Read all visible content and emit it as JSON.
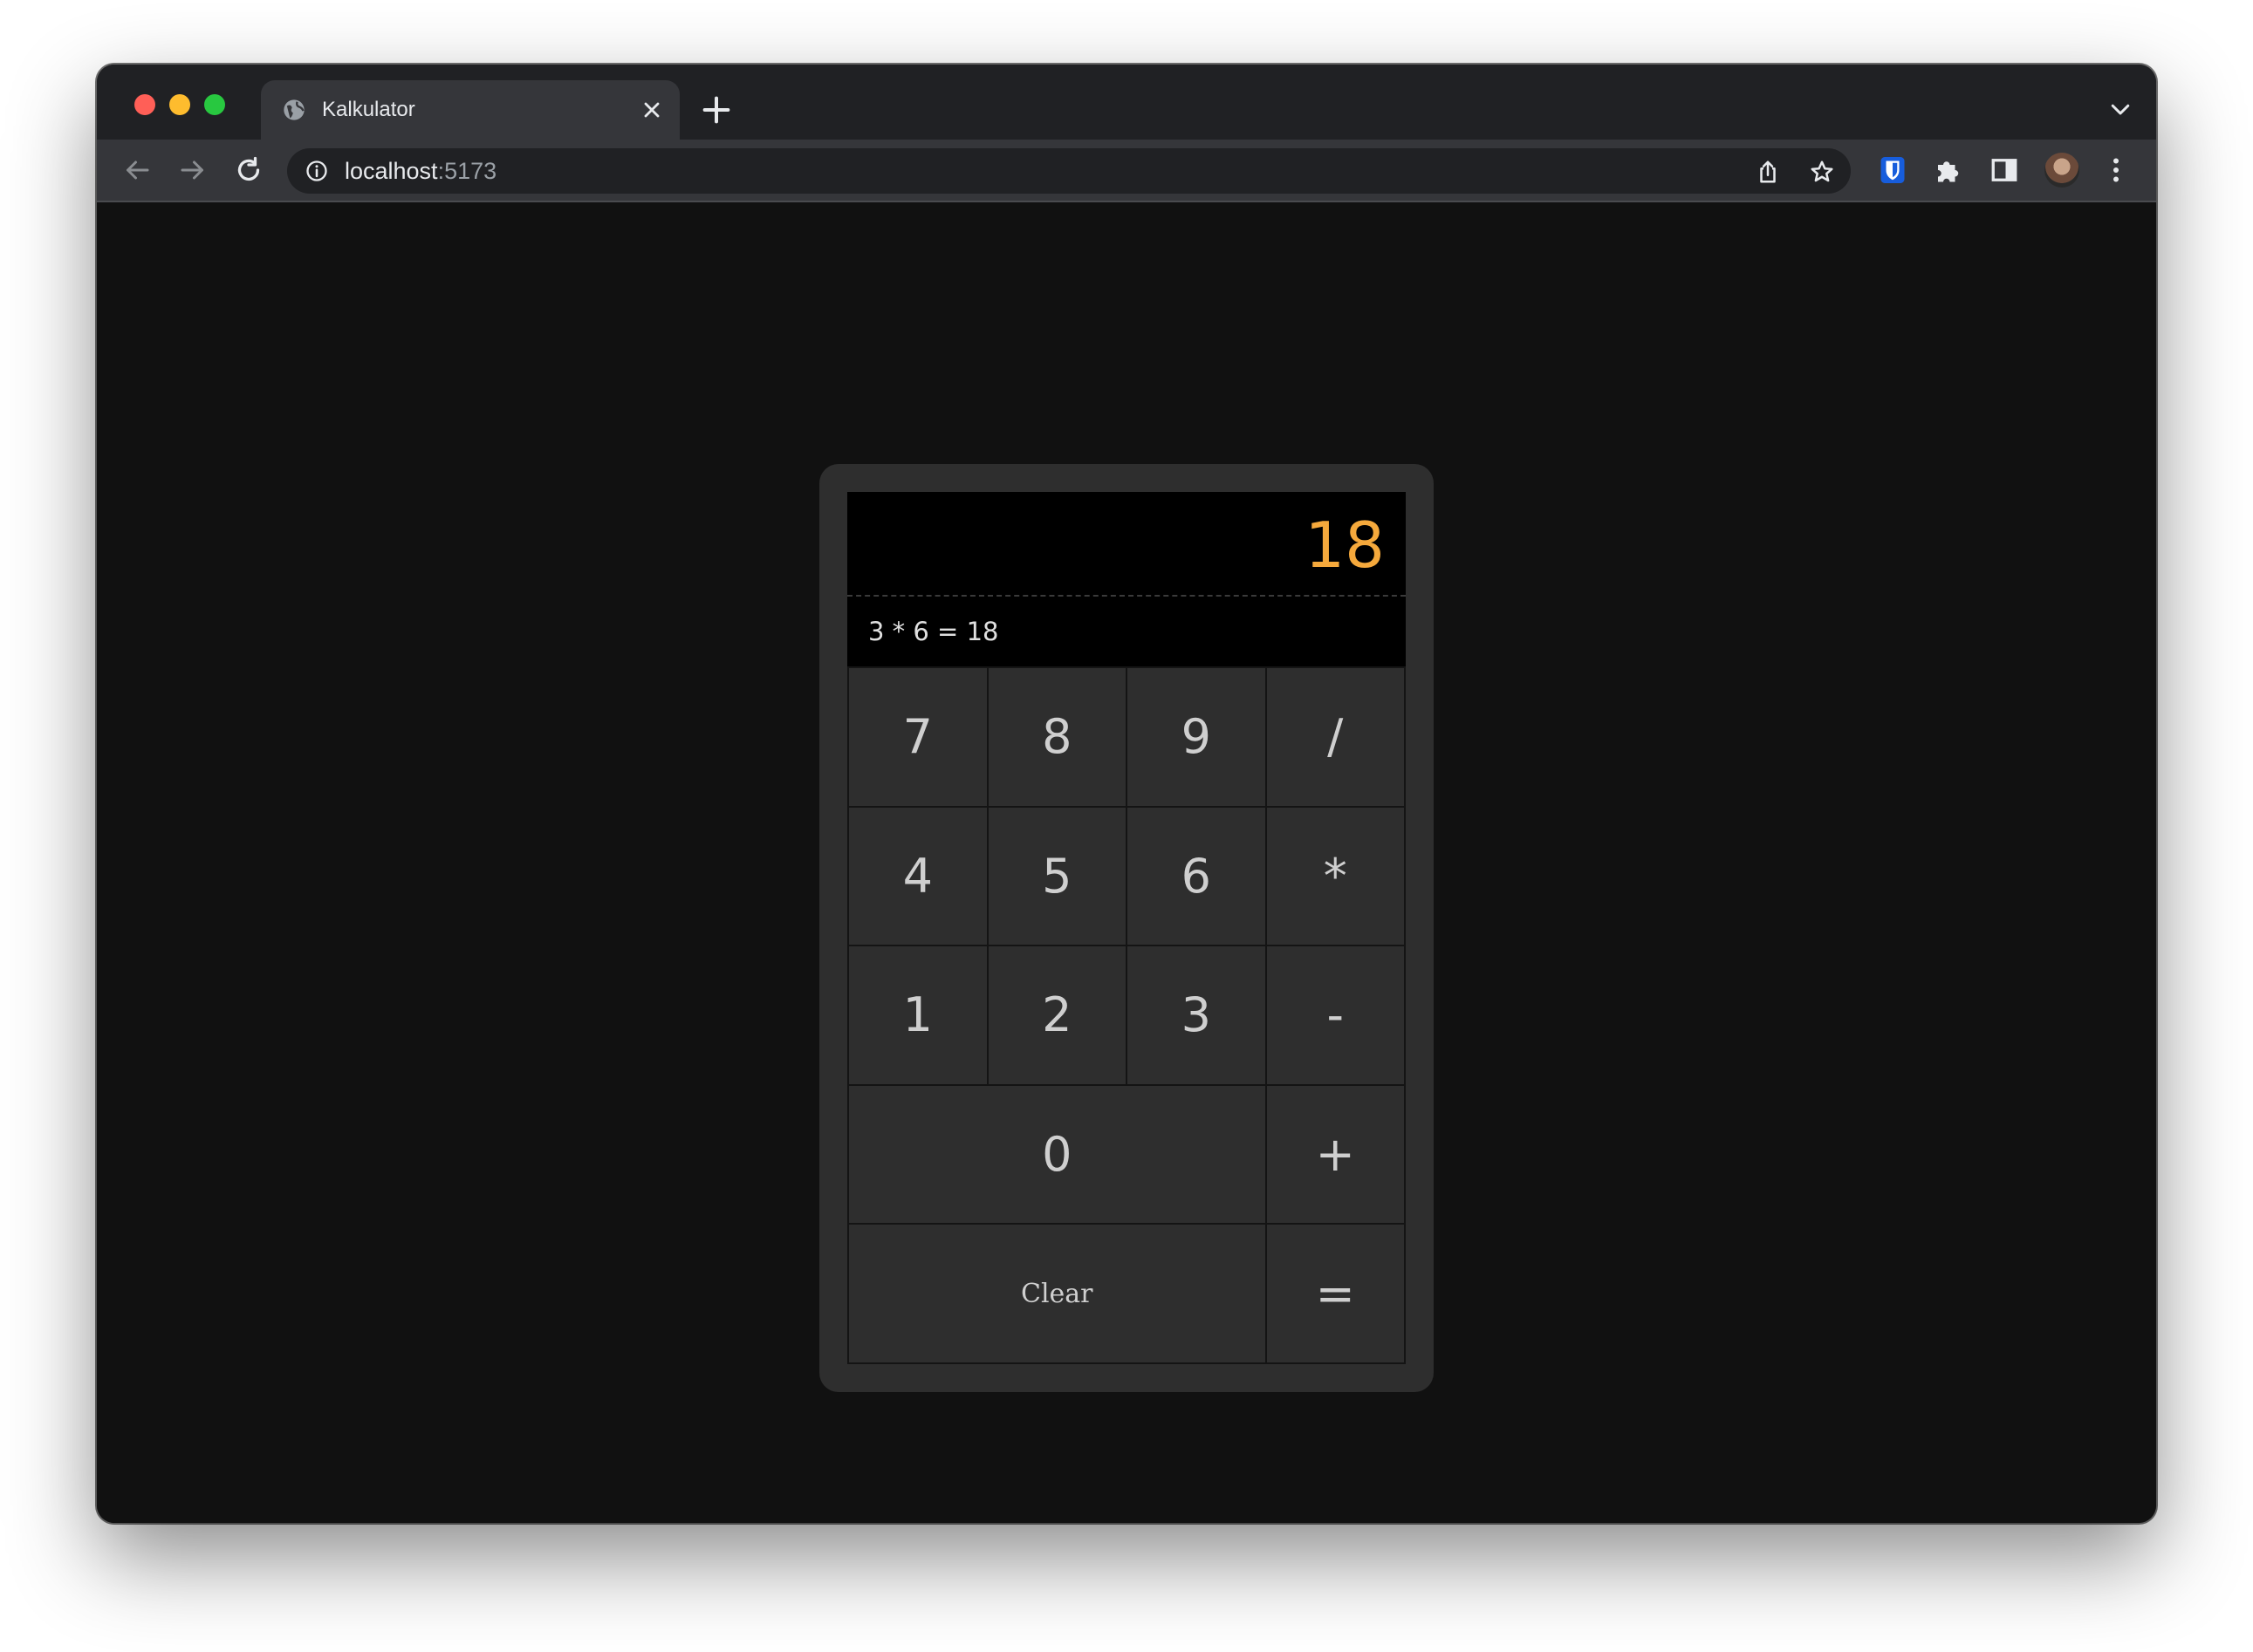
{
  "browser": {
    "tab_title": "Kalkulator",
    "url_host": "localhost",
    "url_port": ":5173"
  },
  "calculator": {
    "result": "18",
    "history": "3 * 6 = 18",
    "keys": {
      "k7": "7",
      "k8": "8",
      "k9": "9",
      "divide": "/",
      "k4": "4",
      "k5": "5",
      "k6": "6",
      "multiply": "*",
      "k1": "1",
      "k2": "2",
      "k3": "3",
      "minus": "-",
      "k0": "0",
      "plus": "+",
      "clear": "Clear",
      "equals": "="
    }
  },
  "colors": {
    "accent_result": "#f5a93c",
    "page_background": "#111111",
    "key_background": "#2e2e2e"
  },
  "icons": [
    "globe-icon",
    "close-icon",
    "plus-icon",
    "chevron-down-icon",
    "back-arrow-icon",
    "forward-arrow-icon",
    "reload-icon",
    "info-icon",
    "share-icon",
    "star-icon",
    "bitwarden-icon",
    "puzzle-icon",
    "sidepanel-icon",
    "avatar",
    "kebab-menu-icon"
  ]
}
